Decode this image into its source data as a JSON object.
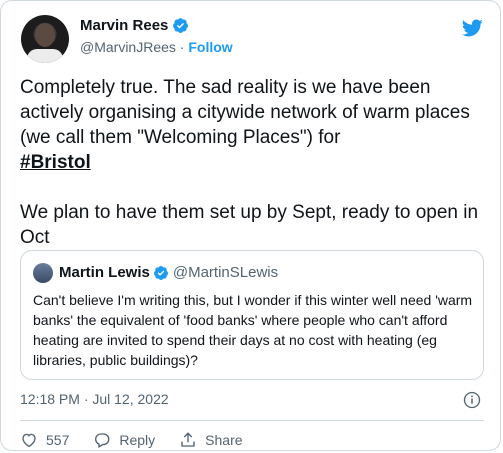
{
  "author": {
    "name": "Marvin Rees",
    "handle": "@MarvinJRees",
    "separator": "·",
    "follow_label": "Follow"
  },
  "tweet": {
    "line1": "Completely true. The sad reality is we have been actively organising a citywide network of warm places (we call them \"Welcoming Places\") for",
    "hashtag": "#Bristol",
    "line2": "We plan to have them set up by Sept, ready to open in Oct"
  },
  "quoted": {
    "name": "Martin Lewis",
    "handle": "@MartinSLewis",
    "text": "Can't believe I'm writing this, but I wonder if this winter well need 'warm banks' the equivalent of 'food banks' where people who can't afford heating are invited to spend their days at no cost with heating (eg libraries, public buildings)?"
  },
  "timestamp": "12:18 PM · Jul 12, 2022",
  "actions": {
    "likes": "557",
    "reply_label": "Reply",
    "share_label": "Share"
  },
  "colors": {
    "accent": "#1d9bf0",
    "text": "#0f1419",
    "muted": "#536471",
    "border": "#cfd9de"
  }
}
